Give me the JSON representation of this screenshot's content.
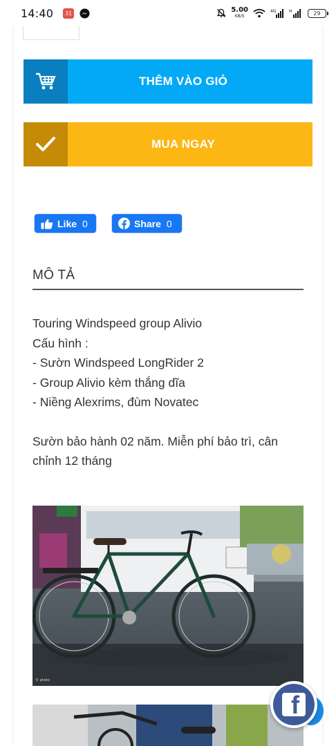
{
  "status_bar": {
    "time": "14:40",
    "notif_badge": "31",
    "net_speed": "5.00",
    "net_unit": "KB/S",
    "battery": "29"
  },
  "actions": {
    "add_to_cart": "THÊM VÀO GIỎ",
    "buy_now": "MUA NGAY"
  },
  "social": {
    "like_label": "Like",
    "like_count": "0",
    "share_label": "Share",
    "share_count": "0"
  },
  "description": {
    "heading": "MÔ TẢ",
    "lines": [
      "Touring Windspeed group Alivio",
      "Cấu hình :",
      "- Sườn Windspeed LongRider 2",
      "- Group Alivio kèm thắng dĩa",
      "- Niềng Alexrims, đùm Novatec"
    ],
    "paragraph2_line1": "Sườn bảo hành 02 năm. Miễn phí bảo trì, cân",
    "paragraph2_line2": "chỉnh 12 tháng"
  },
  "colors": {
    "cart_button": "#04a9f5",
    "buy_button": "#fcb714",
    "facebook_blue": "#1877f2"
  }
}
